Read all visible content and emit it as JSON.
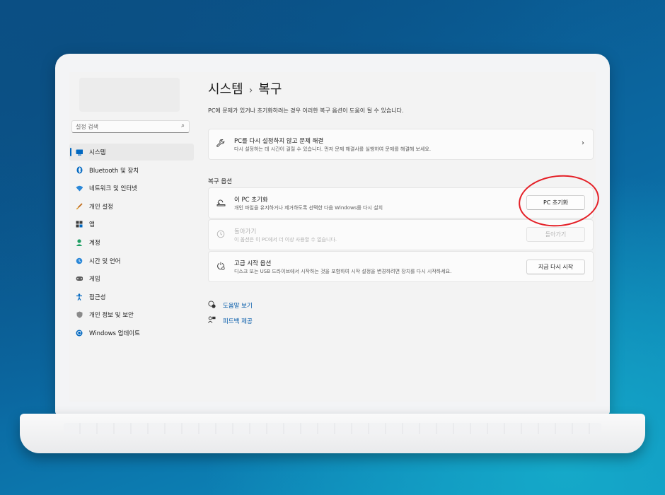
{
  "sidebar": {
    "search_placeholder": "설정 검색",
    "items": [
      {
        "label": "시스템",
        "icon": "display-icon",
        "color": "#0067c0",
        "selected": true
      },
      {
        "label": "Bluetooth 및 장치",
        "icon": "bluetooth-icon",
        "color": "#0067c0"
      },
      {
        "label": "네트워크 및 인터넷",
        "icon": "wifi-icon",
        "color": "#2b88d8"
      },
      {
        "label": "개인 설정",
        "icon": "brush-icon",
        "color": "#c06a17"
      },
      {
        "label": "앱",
        "icon": "apps-icon",
        "color": "#3a3a3a"
      },
      {
        "label": "계정",
        "icon": "person-icon",
        "color": "#1f9e63"
      },
      {
        "label": "시간 및 언어",
        "icon": "globe-clock-icon",
        "color": "#2b88d8"
      },
      {
        "label": "게임",
        "icon": "gamepad-icon",
        "color": "#5c5c5c"
      },
      {
        "label": "접근성",
        "icon": "accessibility-icon",
        "color": "#0067c0"
      },
      {
        "label": "개인 정보 및 보안",
        "icon": "shield-icon",
        "color": "#7a7a7a"
      },
      {
        "label": "Windows 업데이트",
        "icon": "windows-update-icon",
        "color": "#0067c0"
      }
    ]
  },
  "main": {
    "breadcrumb_parent": "시스템",
    "breadcrumb_separator": "›",
    "breadcrumb_current": "복구",
    "description": "PC에 문제가 있거나 초기화하려는 경우 이러한 복구 옵션이 도움이 될 수 있습니다.",
    "troubleshoot_card": {
      "title": "PC를 다시 설정하지 않고 문제 해결",
      "desc": "다시 설정하는 데 시간이 걸릴 수 있습니다. 먼저 문제 해결사를 실행하여 문제를 해결해 보세요."
    },
    "section_title": "복구 옵션",
    "reset_card": {
      "title": "이 PC 초기화",
      "desc": "개인 파일을 유지하거나 제거하도록 선택한 다음 Windows를 다시 설치",
      "button": "PC 초기화"
    },
    "goback_card": {
      "title": "돌아가기",
      "desc": "이 옵션은 이 PC에서 더 이상 사용할 수 없습니다.",
      "button": "돌아가기",
      "enabled": false
    },
    "advanced_card": {
      "title": "고급 시작 옵션",
      "desc": "디스크 또는 USB 드라이브에서 시작하는 것을 포함하여 시작 설정을 변경하려면 장치를 다시 시작하세요.",
      "button": "지금 다시 시작"
    },
    "links": [
      {
        "label": "도움말 보기",
        "icon": "help-icon"
      },
      {
        "label": "피드백 제공",
        "icon": "feedback-icon"
      }
    ]
  },
  "annotation": {
    "color": "#e41f26",
    "target": "PC 초기화"
  }
}
